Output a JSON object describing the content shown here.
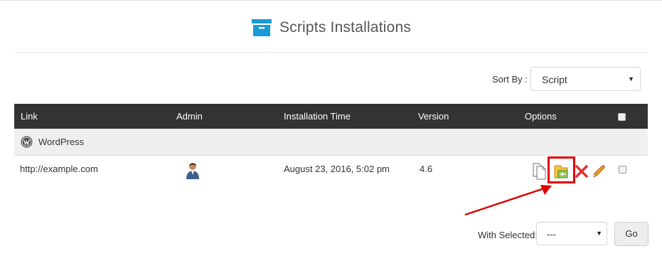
{
  "header": {
    "title": "Scripts Installations",
    "icon": "archive-box-icon",
    "accent": "#1a9bd7"
  },
  "sort": {
    "label": "Sort By :",
    "selected": "Script"
  },
  "table": {
    "columns": [
      "Link",
      "Admin",
      "Installation Time",
      "Version",
      "Options"
    ],
    "group": {
      "name": "WordPress",
      "icon": "wordpress-icon"
    },
    "rows": [
      {
        "link": "http://example.com",
        "admin_icon": "admin-user-icon",
        "installation_time": "August 23, 2016, 5:02 pm",
        "version": "4.6",
        "options": [
          "clone-icon",
          "backup-folder-icon",
          "remove-icon",
          "edit-pencil-icon"
        ]
      }
    ]
  },
  "bulk": {
    "label": "With Selected:",
    "selected": "---",
    "go": "Go"
  },
  "colors": {
    "header_bg": "#333333",
    "group_bg": "#efefef",
    "highlight": "#e00000"
  }
}
